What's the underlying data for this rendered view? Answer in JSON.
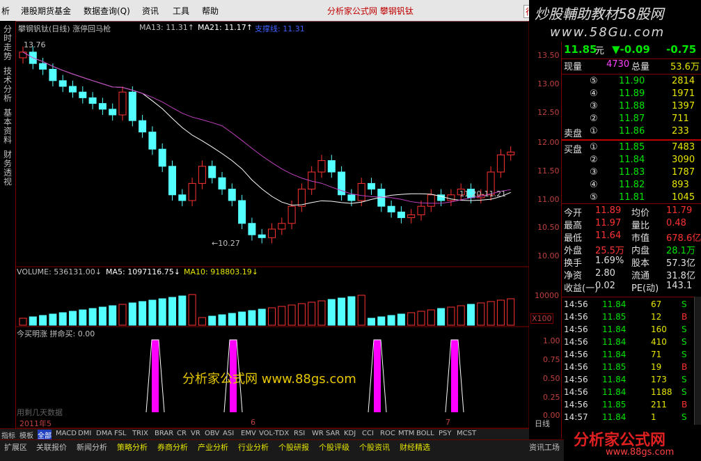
{
  "menu": {
    "items": [
      "析",
      "港股期货基金",
      "数据查询(Q)",
      "资讯",
      "工具",
      "帮助"
    ],
    "window_title": "分析家公式网  攀钢钒钛",
    "right_tab": "行"
  },
  "banner": {
    "line1": "炒股輔助教材58股网",
    "line2": "www.58Gu.com"
  },
  "left_tabs": [
    "分时走势",
    "技术分析",
    "基本资料",
    "财务透视"
  ],
  "main_chart": {
    "title": "攀钢钒钛(日线) 涨停回马枪",
    "ma13_label": "MA13: 11.31↑",
    "ma21_label": "MA21: 11.17↑",
    "ma3_label": "支撑线: 11.31",
    "high_marker": "13.76",
    "low_marker": "←10.27",
    "ma_marker": "11.20-11.21",
    "y_ticks": [
      "13.50",
      "13.00",
      "12.50",
      "12.00",
      "11.50",
      "11.00",
      "10.50",
      "10.00"
    ]
  },
  "volume_chart": {
    "label_vol": "VOLUME: 536131.00↓",
    "label_ma5": "MA5: 1097116.75↓",
    "label_ma10": "MA10: 918803.19↓",
    "y_tick": "10000",
    "unit": "X100"
  },
  "signal_chart": {
    "label": "今买明涨  拼命买: 0.00",
    "y_ticks": [
      "1.00",
      "0.75",
      "0.50",
      "0.25",
      "0.00"
    ],
    "signal_bars": [
      1,
      1,
      1,
      1
    ],
    "watermark": "分析家公式网  www.88gs.com",
    "bottom_text": "用剩几天数据"
  },
  "date_axis": {
    "labels": [
      "2011年5",
      "6",
      "7"
    ],
    "period": "日线"
  },
  "quote": {
    "price": "11.85",
    "price_unit": "元",
    "change": "▼-0.09",
    "pct": "-0.75",
    "now_vol_label": "现量",
    "now_vol": "4730",
    "total_vol_label": "总量",
    "total_vol": "53.6万",
    "sell_label": "卖盘",
    "buy_label": "买盘",
    "asks": [
      {
        "level": "⑤",
        "price": "11.90",
        "vol": "2814"
      },
      {
        "level": "④",
        "price": "11.89",
        "vol": "1971"
      },
      {
        "level": "③",
        "price": "11.88",
        "vol": "1397"
      },
      {
        "level": "②",
        "price": "11.87",
        "vol": "711"
      },
      {
        "level": "①",
        "price": "11.86",
        "vol": "233"
      }
    ],
    "bids": [
      {
        "level": "①",
        "price": "11.85",
        "vol": "7483"
      },
      {
        "level": "②",
        "price": "11.84",
        "vol": "3090"
      },
      {
        "level": "③",
        "price": "11.83",
        "vol": "1787"
      },
      {
        "level": "④",
        "price": "11.82",
        "vol": "893"
      },
      {
        "level": "⑤",
        "price": "11.81",
        "vol": "1045"
      }
    ],
    "stats": [
      {
        "k1": "今开",
        "v1": "11.89",
        "k2": "均价",
        "v2": "11.79"
      },
      {
        "k1": "最高",
        "v1": "11.97",
        "k2": "量比",
        "v2": "0.48"
      },
      {
        "k1": "最低",
        "v1": "11.64",
        "k2": "市值",
        "v2": "678.6亿"
      },
      {
        "k1": "外盘",
        "v1": "25.5万",
        "k2": "内盘",
        "v2": "28.1万"
      },
      {
        "k1": "换手",
        "v1": "1.69%",
        "k2": "股本",
        "v2": "57.3亿"
      },
      {
        "k1": "净资",
        "v1": "2.80",
        "k2": "流通",
        "v2": "31.8亿"
      },
      {
        "k1": "收益(一)",
        "v1": "0.02",
        "k2": "PE(动)",
        "v2": "143.1"
      }
    ],
    "ticks": [
      {
        "time": "14:56",
        "price": "11.84",
        "vol": "67",
        "side": "S"
      },
      {
        "time": "14:56",
        "price": "11.85",
        "vol": "12",
        "side": "B"
      },
      {
        "time": "14:56",
        "price": "11.84",
        "vol": "160",
        "side": "S"
      },
      {
        "time": "14:56",
        "price": "11.84",
        "vol": "410",
        "side": "S"
      },
      {
        "time": "14:56",
        "price": "11.84",
        "vol": "71",
        "side": "S"
      },
      {
        "time": "14:56",
        "price": "11.85",
        "vol": "19",
        "side": "B"
      },
      {
        "time": "14:56",
        "price": "11.84",
        "vol": "173",
        "side": "S"
      },
      {
        "time": "14:56",
        "price": "11.84",
        "vol": "1188",
        "side": "S"
      },
      {
        "time": "14:56",
        "price": "11.85",
        "vol": "211",
        "side": "B"
      },
      {
        "time": "14:57",
        "price": "11.84",
        "vol": "1",
        "side": "S"
      }
    ]
  },
  "indicator_tabs": [
    "指标",
    "模板",
    "全部",
    "MACD",
    "DMI",
    "DMA",
    "FSL",
    "TRIX",
    "BRAR",
    "CR",
    "VR",
    "OBV",
    "ASI",
    "EMV",
    "VOL-TDX",
    "RSI",
    "WR",
    "SAR",
    "KDJ",
    "CCI",
    "ROC",
    "MTM",
    "BOLL",
    "PSY",
    "MCST"
  ],
  "bottom_tabs": [
    "扩展区",
    "关联报价",
    "新闻分析",
    "策略分析",
    "券商分析",
    "产业分析",
    "行业分析",
    "个股研报",
    "个股评级",
    "个股资讯",
    "财经精选"
  ],
  "bottom_right": "资讯工场",
  "footer_logo": "分析家公式网",
  "footer_url": "www.88gs.com",
  "colors": {
    "up": "#ff3232",
    "down": "#54ffff",
    "signal": "#ff00ff",
    "ma13": "#ffffff",
    "ma21": "#c040c0"
  }
}
